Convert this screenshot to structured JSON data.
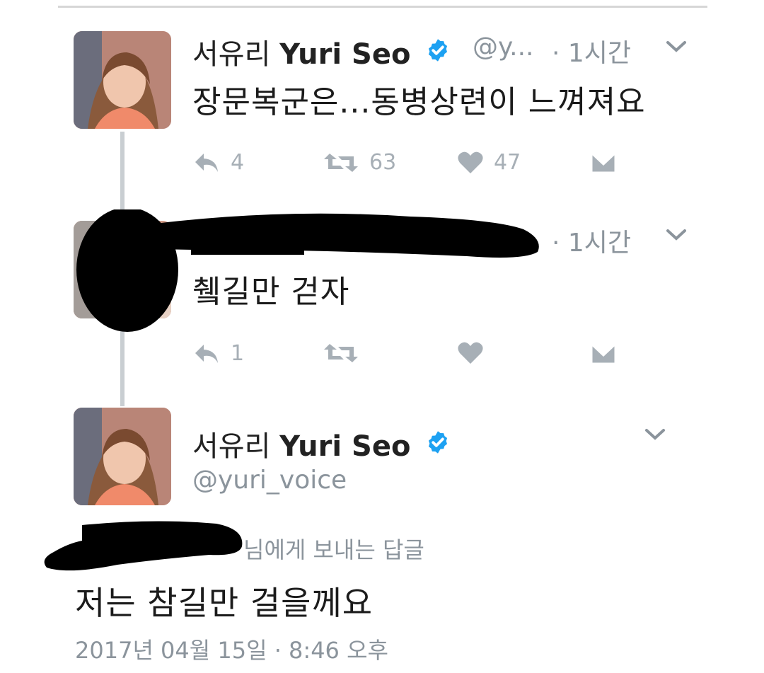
{
  "tweet1": {
    "name_ko": "서유리",
    "name_en": "Yuri Seo",
    "handle": "@y...",
    "time": "· 1시간",
    "text": "장문복군은...동병상련이 느껴져요",
    "replies": "4",
    "retweets": "63",
    "likes": "47"
  },
  "tweet2": {
    "time": "· 1시간",
    "text": "췤길만 걷자",
    "replies": "1"
  },
  "main_tweet": {
    "name_ko": "서유리",
    "name_en": "Yuri Seo",
    "handle": "@yuri_voice",
    "reply_to_suffix": "님에게 보내는 답글",
    "text": "저는 참길만 걸을께요",
    "date": "2017년 04월 15일 · 8:46 오후"
  },
  "colors": {
    "verified": "#1da1f2",
    "action_icon": "#a7afb6",
    "meta_text": "#8b949c",
    "thread_line": "#c9ced2"
  },
  "icons": [
    "verified-badge-icon",
    "chevron-down-icon",
    "reply-icon",
    "retweet-icon",
    "heart-icon",
    "direct-message-icon"
  ]
}
